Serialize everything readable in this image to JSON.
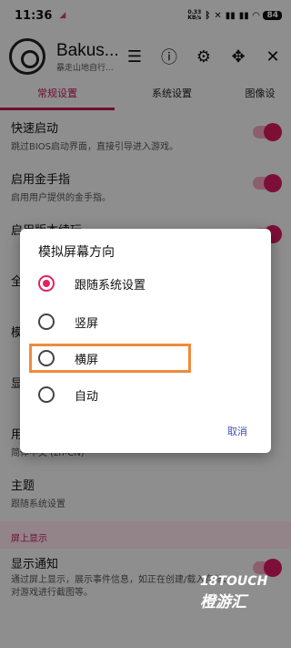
{
  "status_bar": {
    "time": "11:36",
    "network_speed": "0.33",
    "network_unit": "KB/s",
    "battery": "84"
  },
  "app_bar": {
    "title": "Bakus...",
    "subtitle": "暴走山地自行...",
    "icons": [
      "menu-icon",
      "info-icon",
      "gear-icon",
      "gamepad-icon",
      "close-icon"
    ]
  },
  "tabs": [
    {
      "label": "常规设置",
      "active": true
    },
    {
      "label": "系统设置",
      "active": false
    },
    {
      "label": "图像设",
      "active": false
    }
  ],
  "settings": [
    {
      "title": "快速启动",
      "desc": "跳过BIOS启动界面，直接引导进入游戏。",
      "toggle": true
    },
    {
      "title": "启用金手指",
      "desc": "启用用户提供的金手指。",
      "toggle": true
    },
    {
      "title": "启用版本续玩",
      "desc": "",
      "toggle": true
    },
    {
      "title": "全",
      "desc": "",
      "toggle": false
    },
    {
      "title": "模",
      "desc": "",
      "toggle": false
    },
    {
      "title": "显",
      "desc": "",
      "toggle": false
    },
    {
      "title": "用",
      "desc": "简体中文 (zh-CN)",
      "toggle": false
    },
    {
      "title": "主题",
      "desc": "跟随系统设置",
      "toggle": false
    }
  ],
  "section_label": "屏上显示",
  "notification_row": {
    "title": "显示通知",
    "desc": "通过屏上显示，展示事件信息，如正在创建/载入存档、对游戏进行截图等。"
  },
  "dialog": {
    "title": "模拟屏幕方向",
    "options": [
      "跟随系统设置",
      "竖屏",
      "横屏",
      "自动"
    ],
    "selected": "跟随系统设置",
    "cancel_label": "取消"
  },
  "watermark": {
    "line1": "18TOUCH",
    "line2": "橙游汇"
  }
}
